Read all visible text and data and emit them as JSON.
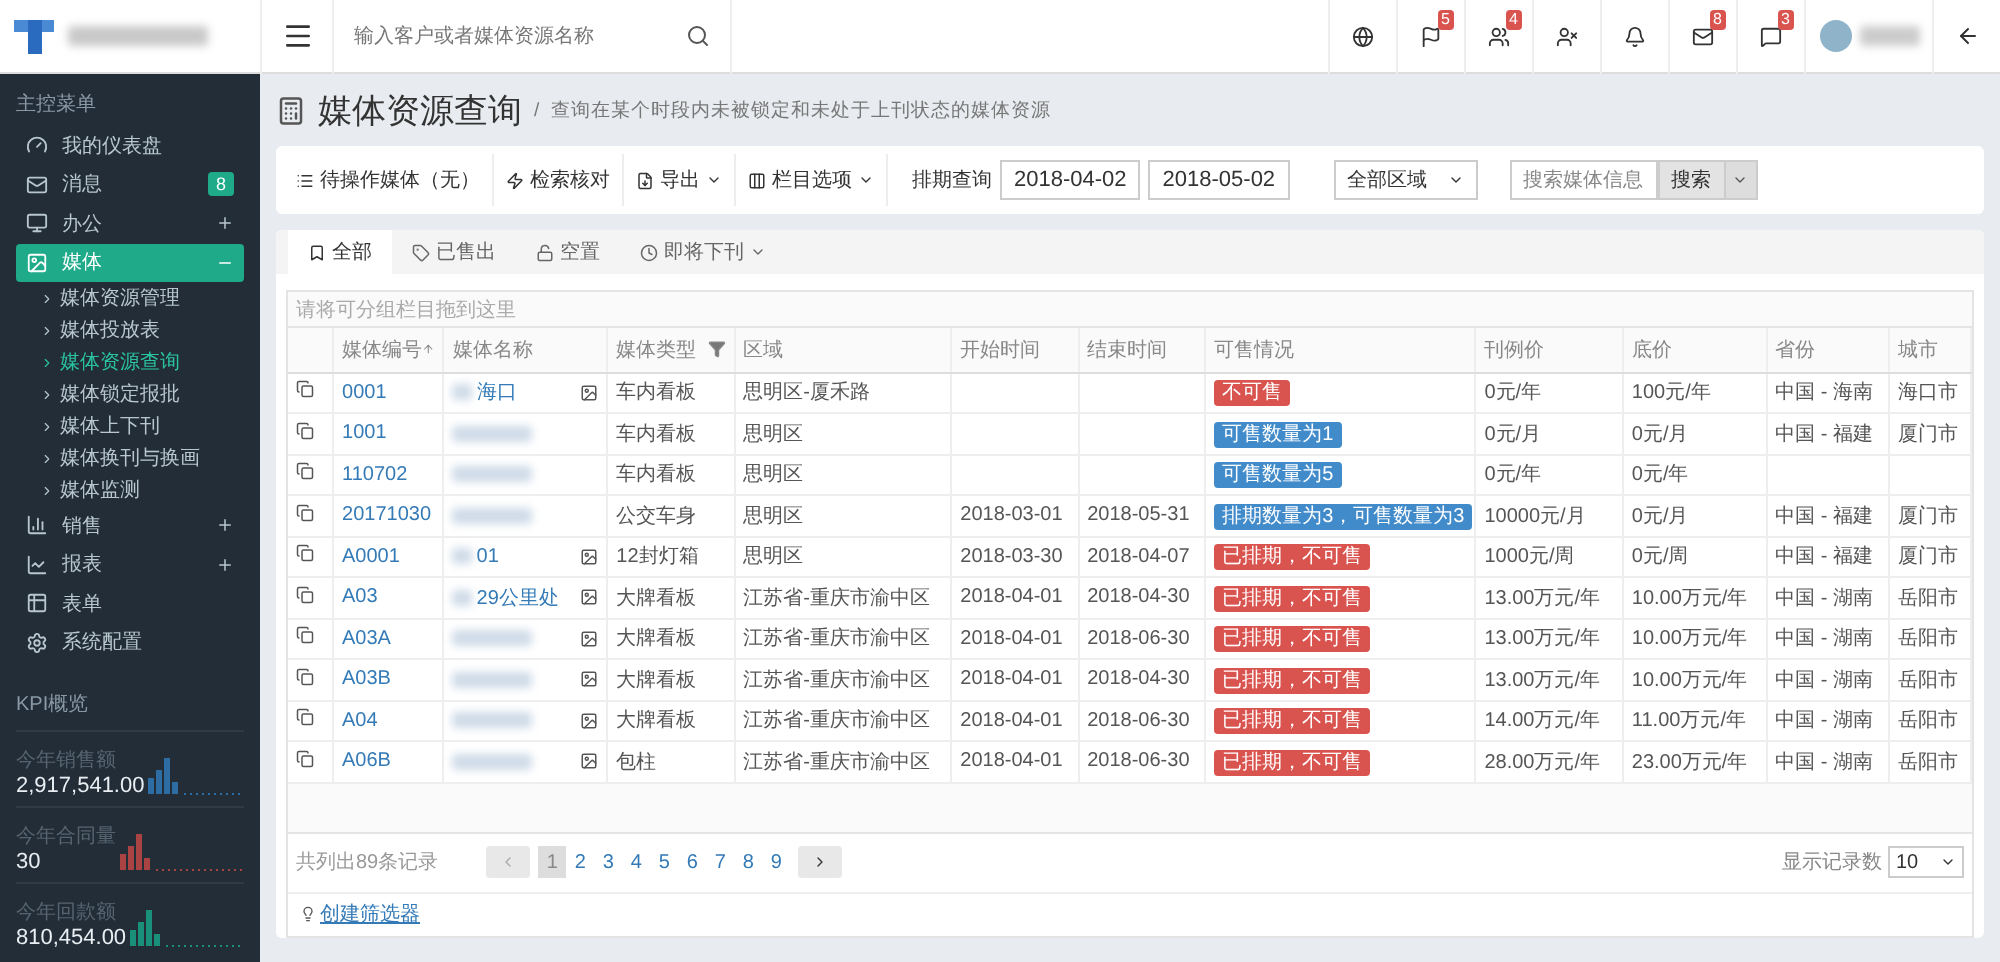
{
  "sidebar": {
    "menu_title": "主控菜单",
    "items": [
      {
        "label": "我的仪表盘",
        "selected": false
      },
      {
        "label": "消息",
        "selected": false,
        "badge": "8"
      },
      {
        "label": "办公",
        "selected": false,
        "expanded": false
      },
      {
        "label": "媒体",
        "selected": true,
        "expanded": true,
        "children": [
          {
            "label": "媒体资源管理",
            "selected": false
          },
          {
            "label": "媒体投放表",
            "selected": false
          },
          {
            "label": "媒体资源查询",
            "selected": true
          },
          {
            "label": "媒体锁定报批",
            "selected": false
          },
          {
            "label": "媒体上下刊",
            "selected": false
          },
          {
            "label": "媒体换刊与换画",
            "selected": false
          },
          {
            "label": "媒体监测",
            "selected": false
          }
        ]
      },
      {
        "label": "销售",
        "selected": false,
        "expanded": false
      },
      {
        "label": "报表",
        "selected": false,
        "expanded": false
      },
      {
        "label": "表单",
        "selected": false
      },
      {
        "label": "系统配置",
        "selected": false
      }
    ],
    "kpi": {
      "title": "KPI概览",
      "items": [
        {
          "label": "今年销售额",
          "value": "2,917,541.00",
          "color": "#2e6da4"
        },
        {
          "label": "今年合同量",
          "value": "30",
          "color": "#a94442"
        },
        {
          "label": "今年回款额",
          "value": "810,454.00",
          "color": "#1a8f7a"
        }
      ]
    }
  },
  "topbar": {
    "search_placeholder": "输入客户或者媒体资源名称",
    "badges": [
      "5",
      "4",
      "8",
      "3"
    ]
  },
  "page_header": {
    "title": "媒体资源查询",
    "separator": "/",
    "subtitle": "查询在某个时段内未被锁定和未处于上刊状态的媒体资源"
  },
  "toolbar": {
    "buttons": [
      {
        "label": "待操作媒体（无）",
        "dropdown": false
      },
      {
        "label": "检索核对",
        "dropdown": false
      },
      {
        "label": "导出",
        "dropdown": true
      },
      {
        "label": "栏目选项",
        "dropdown": true
      }
    ],
    "date_label": "排期查询",
    "start_date": "2018-04-02",
    "end_date": "2018-05-02",
    "region_select": "全部区域",
    "search_placeholder": "搜索媒体信息",
    "search_button": "搜索"
  },
  "tabs": [
    {
      "label": "全部",
      "selected": true,
      "dropdown": false
    },
    {
      "label": "已售出",
      "selected": false,
      "dropdown": false
    },
    {
      "label": "空置",
      "selected": false,
      "dropdown": false
    },
    {
      "label": "即将下刊",
      "selected": false,
      "dropdown": true
    }
  ],
  "table": {
    "group_hint": "请将可分组栏目拖到这里",
    "columns": [
      {
        "label": "媒体编号",
        "sort_ascending": true
      },
      {
        "label": "媒体名称"
      },
      {
        "label": "媒体类型",
        "filter": true
      },
      {
        "label": "区域"
      },
      {
        "label": "开始时间"
      },
      {
        "label": "结束时间"
      },
      {
        "label": "可售情况"
      },
      {
        "label": "刊例价"
      },
      {
        "label": "底价"
      },
      {
        "label": "省份"
      },
      {
        "label": "城市"
      }
    ],
    "rows": [
      {
        "id": "0001",
        "name": "海口",
        "has_image": true,
        "type": "车内看板",
        "area": "思明区-厦禾路",
        "status": {
          "text": "不可售",
          "kind": "danger"
        },
        "list_price": "0元/年",
        "floor_price": "100元/年",
        "province": "中国 - 海南",
        "city": "海口市"
      },
      {
        "id": "1001",
        "has_image": false,
        "type": "车内看板",
        "area": "思明区",
        "status": {
          "text": "可售数量为1",
          "kind": "info"
        },
        "list_price": "0元/月",
        "floor_price": "0元/月",
        "province": "中国 - 福建",
        "city": "厦门市"
      },
      {
        "id": "110702",
        "has_image": false,
        "type": "车内看板",
        "area": "思明区",
        "status": {
          "text": "可售数量为5",
          "kind": "info"
        },
        "list_price": "0元/年",
        "floor_price": "0元/年"
      },
      {
        "id": "20171030",
        "has_image": false,
        "type": "公交车身",
        "area": "思明区",
        "start": "2018-03-01",
        "end": "2018-05-31",
        "status": {
          "text": "排期数量为3，可售数量为3",
          "kind": "info"
        },
        "list_price": "10000元/月",
        "floor_price": "0元/月",
        "province": "中国 - 福建",
        "city": "厦门市"
      },
      {
        "id": "A0001",
        "name": "01",
        "has_image": true,
        "type": "12封灯箱",
        "area": "思明区",
        "start": "2018-03-30",
        "end": "2018-04-07",
        "status": {
          "text": "已排期，不可售",
          "kind": "danger"
        },
        "list_price": "1000元/周",
        "floor_price": "0元/周",
        "province": "中国 - 福建",
        "city": "厦门市"
      },
      {
        "id": "A03",
        "name": "29公里处",
        "has_image": true,
        "type": "大牌看板",
        "area": "江苏省-重庆市渝中区",
        "start": "2018-04-01",
        "end": "2018-04-30",
        "status": {
          "text": "已排期，不可售",
          "kind": "danger"
        },
        "list_price": "13.00万元/年",
        "floor_price": "10.00万元/年",
        "province": "中国 - 湖南",
        "city": "岳阳市"
      },
      {
        "id": "A03A",
        "has_image": true,
        "type": "大牌看板",
        "area": "江苏省-重庆市渝中区",
        "start": "2018-04-01",
        "end": "2018-06-30",
        "status": {
          "text": "已排期，不可售",
          "kind": "danger"
        },
        "list_price": "13.00万元/年",
        "floor_price": "10.00万元/年",
        "province": "中国 - 湖南",
        "city": "岳阳市"
      },
      {
        "id": "A03B",
        "has_image": true,
        "type": "大牌看板",
        "area": "江苏省-重庆市渝中区",
        "start": "2018-04-01",
        "end": "2018-04-30",
        "status": {
          "text": "已排期，不可售",
          "kind": "danger"
        },
        "list_price": "13.00万元/年",
        "floor_price": "10.00万元/年",
        "province": "中国 - 湖南",
        "city": "岳阳市"
      },
      {
        "id": "A04",
        "has_image": true,
        "type": "大牌看板",
        "area": "江苏省-重庆市渝中区",
        "start": "2018-04-01",
        "end": "2018-06-30",
        "status": {
          "text": "已排期，不可售",
          "kind": "danger"
        },
        "list_price": "14.00万元/年",
        "floor_price": "11.00万元/年",
        "province": "中国 - 湖南",
        "city": "岳阳市"
      },
      {
        "id": "A06B",
        "has_image": true,
        "type": "包柱",
        "area": "江苏省-重庆市渝中区",
        "start": "2018-04-01",
        "end": "2018-06-30",
        "status": {
          "text": "已排期，不可售",
          "kind": "danger"
        },
        "list_price": "28.00万元/年",
        "floor_price": "23.00万元/年",
        "province": "中国 - 湖南",
        "city": "岳阳市"
      }
    ]
  },
  "pagination": {
    "summary": "共列出89条记录",
    "pages": [
      {
        "label": "1",
        "selected": true
      },
      {
        "label": "2",
        "selected": false
      },
      {
        "label": "3",
        "selected": false
      },
      {
        "label": "4",
        "selected": false
      },
      {
        "label": "5",
        "selected": false
      },
      {
        "label": "6",
        "selected": false
      },
      {
        "label": "7",
        "selected": false
      },
      {
        "label": "8",
        "selected": false
      },
      {
        "label": "9",
        "selected": false
      }
    ],
    "page_size_label": "显示记录数",
    "page_size": "10"
  },
  "filter_link": "创建筛选器"
}
